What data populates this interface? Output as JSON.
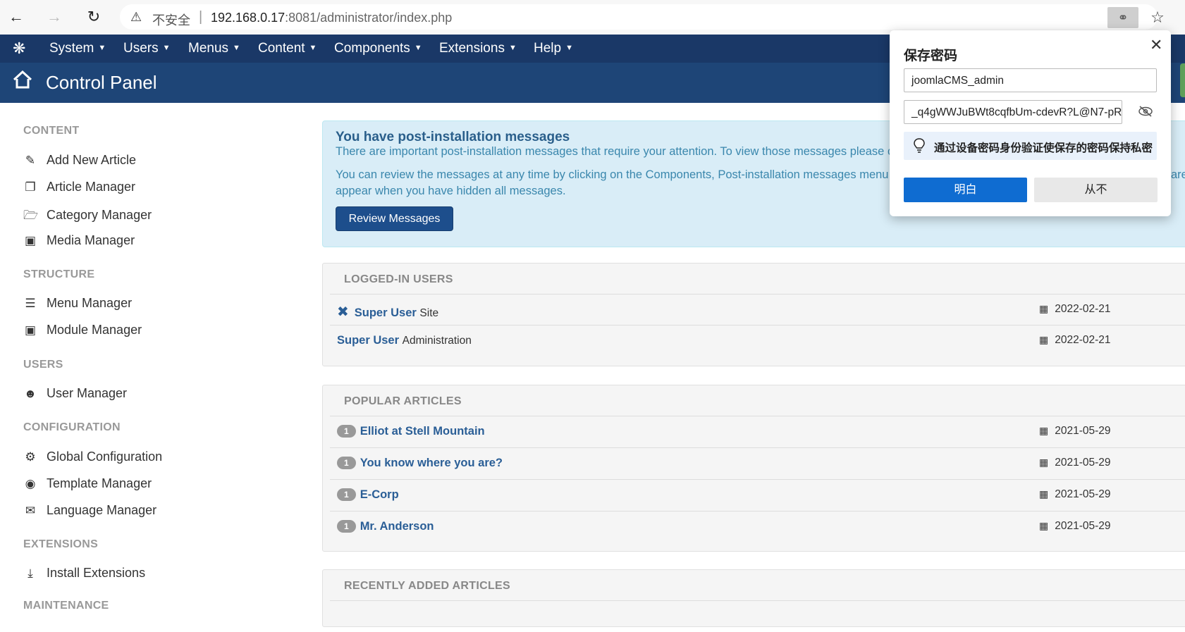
{
  "browser": {
    "insecure_label": "不安全",
    "separator": "|",
    "url_host": "192.168.0.17",
    "url_port_path": ":8081/administrator/index.php"
  },
  "topmenu": {
    "items": [
      {
        "label": "System"
      },
      {
        "label": "Users"
      },
      {
        "label": "Menus"
      },
      {
        "label": "Content"
      },
      {
        "label": "Components"
      },
      {
        "label": "Extensions"
      },
      {
        "label": "Help"
      }
    ]
  },
  "header": {
    "title": "Control Panel"
  },
  "sidebar": {
    "content_heading": "CONTENT",
    "content_items": [
      "Add New Article",
      "Article Manager",
      "Category Manager",
      "Media Manager"
    ],
    "structure_heading": "STRUCTURE",
    "structure_items": [
      "Menu Manager",
      "Module Manager"
    ],
    "users_heading": "USERS",
    "users_items": [
      "User Manager"
    ],
    "configuration_heading": "CONFIGURATION",
    "configuration_items": [
      "Global Configuration",
      "Template Manager",
      "Language Manager"
    ],
    "extensions_heading": "EXTENSIONS",
    "extensions_items": [
      "Install Extensions"
    ],
    "maintenance_heading": "MAINTENANCE"
  },
  "postinstall": {
    "title": "You have post-installation messages",
    "line1": "There are important post-installation messages that require your attention. To view those messages please cli",
    "line2": "You can review the messages at any time by clicking on the Components, Post-installation messages menu it",
    "line2_end": "are",
    "line3": "appear when you have hidden all messages.",
    "button": "Review Messages"
  },
  "logged_in": {
    "title": "LOGGED-IN USERS",
    "rows": [
      {
        "name": "Super User",
        "sub": "Site",
        "date": "2022-02-21"
      },
      {
        "name": "Super User",
        "sub": "Administration",
        "date": "2022-02-21"
      }
    ]
  },
  "popular": {
    "title": "POPULAR ARTICLES",
    "rows": [
      {
        "hits": "1",
        "name": "Elliot at Stell Mountain",
        "date": "2021-05-29"
      },
      {
        "hits": "1",
        "name": "You know where you are?",
        "date": "2021-05-29"
      },
      {
        "hits": "1",
        "name": "E-Corp",
        "date": "2021-05-29"
      },
      {
        "hits": "1",
        "name": "Mr. Anderson",
        "date": "2021-05-29"
      }
    ]
  },
  "recent": {
    "title": "RECENTLY ADDED ARTICLES"
  },
  "password_popup": {
    "title": "保存密码",
    "username": "joomlaCMS_admin",
    "password": "_q4gWWJuBWt8cqfbUm-cdevR?L@N7-pR",
    "tip": "通过设备密码身份验证使保存的密码保持私密",
    "ok": "明白",
    "never": "从不"
  },
  "colors": {
    "menu_bg": "#1a3867",
    "header_bg": "#1e4577",
    "link": "#2a5e96",
    "info_bg": "#d9edf7",
    "popup_primary": "#0f6cd1"
  }
}
